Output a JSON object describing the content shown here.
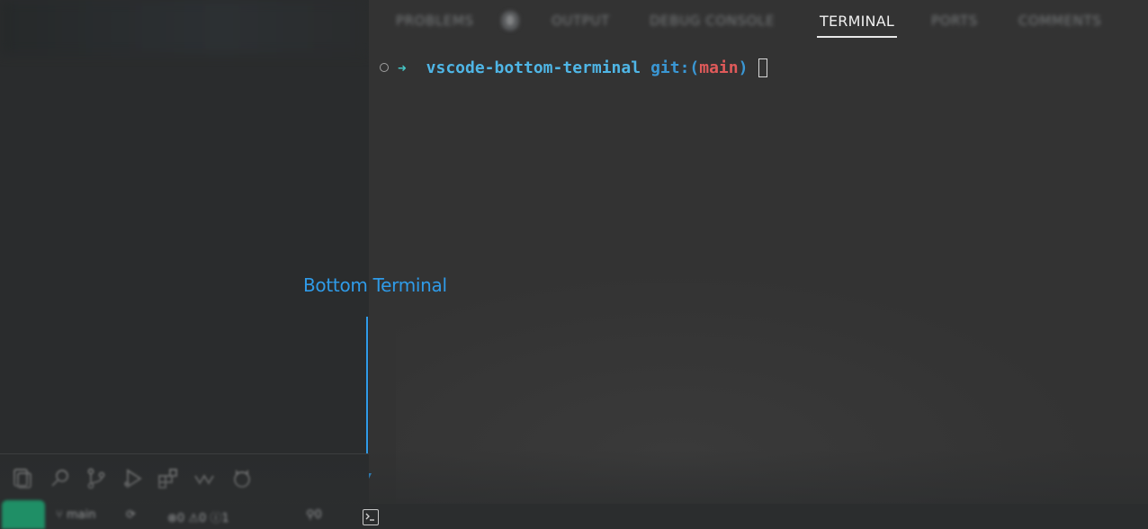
{
  "panel": {
    "tabs": [
      {
        "label": "PROBLEMS",
        "active": false
      },
      {
        "label": "OUTPUT",
        "active": false
      },
      {
        "label": "DEBUG CONSOLE",
        "active": false
      },
      {
        "label": "TERMINAL",
        "active": true
      },
      {
        "label": "PORTS",
        "active": false
      },
      {
        "label": "COMMENTS",
        "active": false
      }
    ],
    "problems_badge": "0"
  },
  "terminal": {
    "directory": "vscode-bottom-terminal",
    "git_label": "git:(",
    "branch": "main",
    "git_close": ")",
    "arrow": "➜"
  },
  "annotation": {
    "label": "Bottom Terminal",
    "color": "#2f9be8"
  },
  "activity_bar": {
    "icons": [
      "files-icon",
      "search-icon",
      "source-control-icon",
      "run-debug-icon",
      "extensions-icon",
      "remote-explorer-icon",
      "github-icon"
    ]
  },
  "status_bar": {
    "branch": "main",
    "errors": "0",
    "warnings": "0",
    "info": "1",
    "ports": "0",
    "remote_color": "#1f8f66"
  },
  "colors": {
    "terminal_dir": "#4fb6e6",
    "terminal_branch": "#e05a5a",
    "terminal_arrow": "#45c6c6"
  }
}
